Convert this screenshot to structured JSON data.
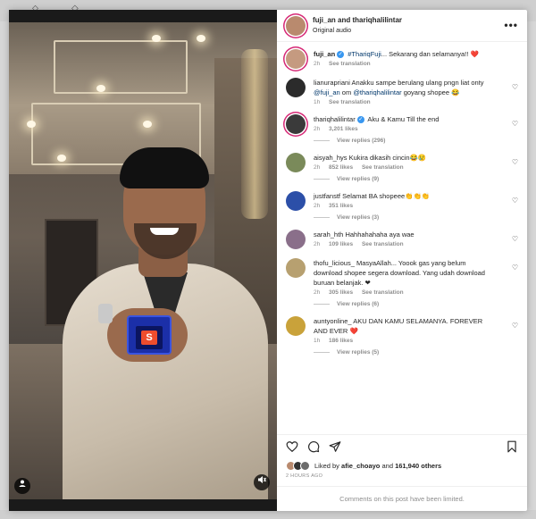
{
  "post": {
    "header": {
      "title": "fuji_an and thariqhalilintar",
      "subtitle": "Original audio",
      "more_label": "•••"
    },
    "caption": {
      "user": "fuji_an",
      "verified": true,
      "text_mention": "#ThariqFuji",
      "text_rest": "... Sekarang dan selamanya!! ",
      "heart": "❤️",
      "time": "2h",
      "see_translation": "See translation"
    },
    "comments": [
      {
        "user": "lianurapriani",
        "verified": false,
        "text_a": "Anakku sampe berulang ulang pngn liat onty ",
        "mention1": "@fuji_an",
        "text_b": " om ",
        "mention2": "@thariqhalilintar",
        "text_c": " goyang shopee 😂",
        "time": "1h",
        "see_translation": "See translation"
      },
      {
        "user": "thariqhalilintar",
        "verified": true,
        "text": "Aku & Kamu Till the end",
        "time": "2h",
        "likes": "3,201 likes",
        "replies": "View replies (296)"
      },
      {
        "user": "aisyah_hys",
        "verified": false,
        "text": "Kukira dikasih cincin😂😢",
        "time": "2h",
        "likes": "852 likes",
        "see_translation": "See translation",
        "replies": "View replies (9)"
      },
      {
        "user": "justfanstf",
        "verified": false,
        "text": "Selamat BA shopeee👏👏👏",
        "time": "2h",
        "likes": "351 likes",
        "replies": "View replies (3)"
      },
      {
        "user": "sarah_hth",
        "verified": false,
        "text": "Hahhahahaha aya wae",
        "time": "2h",
        "likes": "109 likes",
        "see_translation": "See translation"
      },
      {
        "user": "thofu_licious_",
        "verified": false,
        "text": "MasyaAllah... Yoook gas yang belum download shopee segera download. Yang udah download buruan belanjak. ❤",
        "time": "2h",
        "likes": "305 likes",
        "see_translation": "See translation",
        "replies": "View replies (6)"
      },
      {
        "user": "auntyonline_",
        "verified": false,
        "text": "AKU DAN KAMU SELAMANYA. FOREVER AND EVER ",
        "heart": "❤️",
        "time": "1h",
        "likes": "186 likes",
        "replies": "View replies (5)"
      }
    ],
    "likes_line": {
      "prefix": "Liked by ",
      "user": "afie_choayo",
      "middle": " and ",
      "count": "161,940 others"
    },
    "timestamp": "2 HOURS AGO",
    "limited_notice": "Comments on this post have been limited."
  },
  "media": {
    "shop_letter": "S"
  },
  "icons": {
    "heart": "heart-icon",
    "comment": "comment-icon",
    "share": "share-icon",
    "save": "bookmark-icon",
    "tag_user": "user-tag-icon",
    "audio": "speaker-icon"
  },
  "colors": {
    "verified": "#3897f0",
    "mention": "#00376b",
    "secondary_text": "#8e8e8e",
    "heart_red": "#ed4956",
    "story_ring": "#d62976"
  }
}
